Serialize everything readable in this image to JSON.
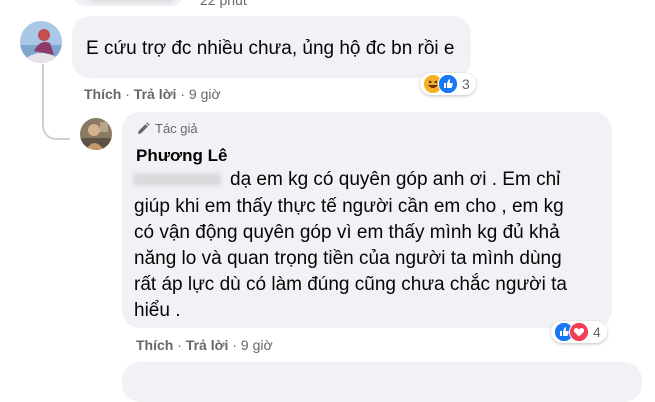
{
  "top_comment": {
    "time_above": "22 phút",
    "text": "E cứu trợ đc nhiều chưa, ủng hộ đc bn rồi e",
    "actions": {
      "like": "Thích",
      "reply": "Trả lời",
      "time": "9 giờ",
      "separator": "·"
    },
    "reactions": {
      "count": "3",
      "types": [
        "haha",
        "like"
      ]
    }
  },
  "reply_comment": {
    "author_badge": "Tác giả",
    "author_name": "Phương Lê",
    "lines": [
      "dạ em kg có quyên góp anh ơi . Em chỉ",
      "giúp khi em thấy thực tế người cần em cho , em kg",
      "có vận động quyên góp vì em thấy mình kg đủ khả",
      "năng lo và quan trọng tiền của người ta mình dùng",
      "rất áp lực dù có làm đúng cũng chưa chắc người ta",
      "hiểu ."
    ],
    "actions": {
      "like": "Thích",
      "reply": "Trả lời",
      "time": "9 giờ",
      "separator": "·"
    },
    "reactions": {
      "count": "4",
      "types": [
        "like",
        "love"
      ]
    }
  },
  "colors": {
    "bubble": "#f0f2f5",
    "secondary_text": "#65676b",
    "like_blue": "#1877f2",
    "love_red": "#f33e58",
    "haha_yellow": "#f7b125"
  }
}
